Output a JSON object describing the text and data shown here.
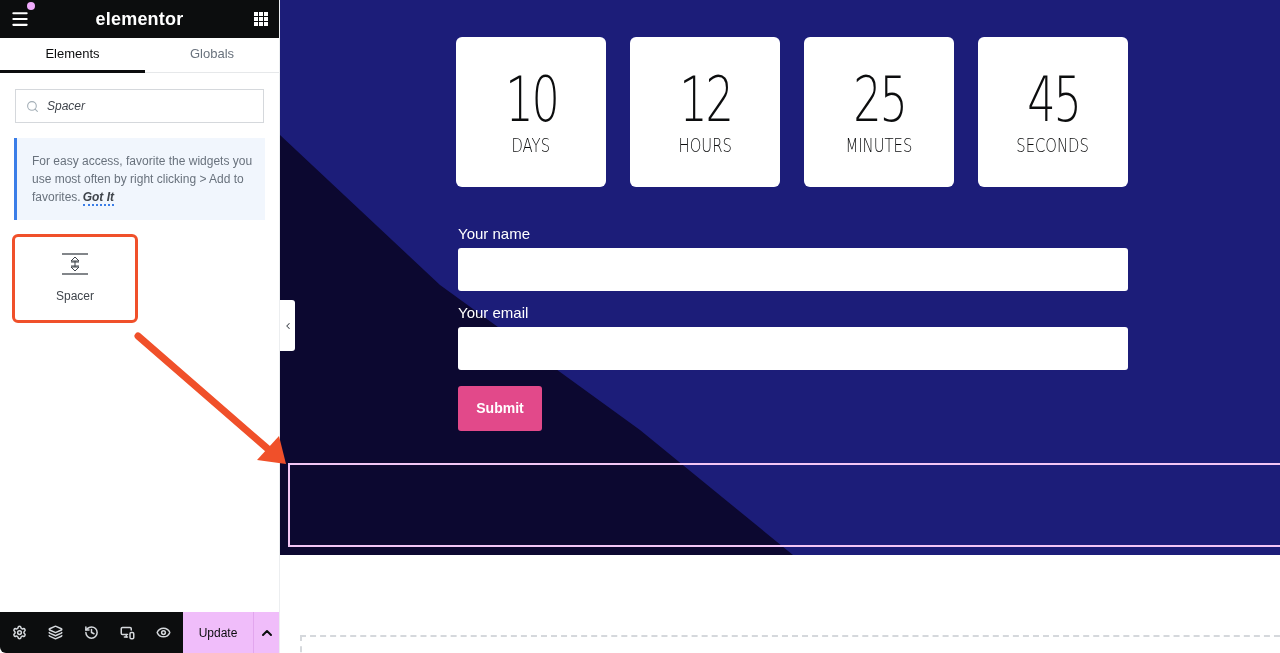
{
  "header": {
    "logo": "elementor",
    "menu_notification": true
  },
  "tabs": [
    {
      "label": "Elements",
      "selected": true
    },
    {
      "label": "Globals",
      "selected": false
    }
  ],
  "search": {
    "value": "Spacer"
  },
  "tip": {
    "text": "For easy access, favorite the widgets you use most often by right clicking > Add to favorites.",
    "link": "Got It"
  },
  "widgets": [
    {
      "label": "Spacer",
      "highlighted": true
    }
  ],
  "footer": {
    "update_button": "Update"
  },
  "countdown": [
    {
      "value": "10",
      "label": "DAYS"
    },
    {
      "value": "12",
      "label": "HOURS"
    },
    {
      "value": "25",
      "label": "MINUTES"
    },
    {
      "value": "45",
      "label": "SECONDS"
    }
  ],
  "form": {
    "fields": [
      {
        "label": "Your name"
      },
      {
        "label": "Your email"
      }
    ],
    "submit": "Submit"
  },
  "spacer_section": {
    "selected": true
  }
}
